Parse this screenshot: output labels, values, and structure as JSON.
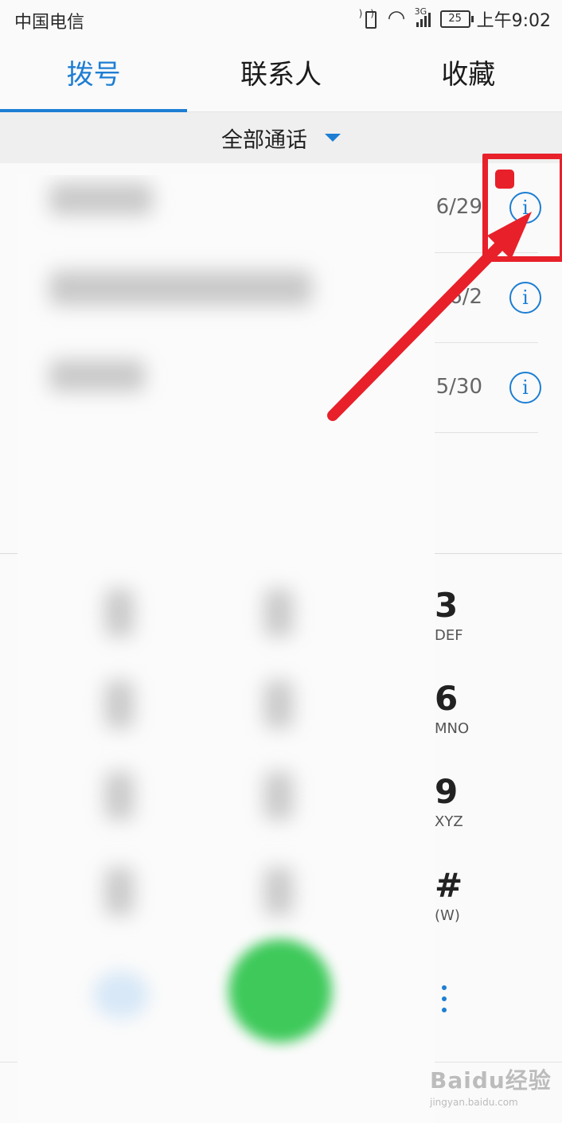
{
  "status_bar": {
    "carrier": "中国电信",
    "network": "3G",
    "battery": "25",
    "time": "上午9:02"
  },
  "tabs": [
    {
      "label": "拨号",
      "active": true
    },
    {
      "label": "联系人",
      "active": false
    },
    {
      "label": "收藏",
      "active": false
    }
  ],
  "filter": {
    "label": "全部通话"
  },
  "call_log": [
    {
      "date": "6/29",
      "info_icon": "info-icon"
    },
    {
      "date": "6/2",
      "info_icon": "info-icon"
    },
    {
      "date": "5/30",
      "info_icon": "info-icon"
    }
  ],
  "dialpad": {
    "keys": [
      {
        "num": "3",
        "letters": "DEF"
      },
      {
        "num": "6",
        "letters": "MNO"
      },
      {
        "num": "9",
        "letters": "XYZ"
      },
      {
        "num": "#",
        "letters": "(W)"
      }
    ],
    "menu_icon": "more-vert-icon"
  },
  "watermark": {
    "brand": "Baidu经验",
    "url": "jingyan.baidu.com"
  },
  "colors": {
    "accent": "#1d7ed3",
    "call_green": "#3ec95a",
    "annotation_red": "#e8202a"
  }
}
